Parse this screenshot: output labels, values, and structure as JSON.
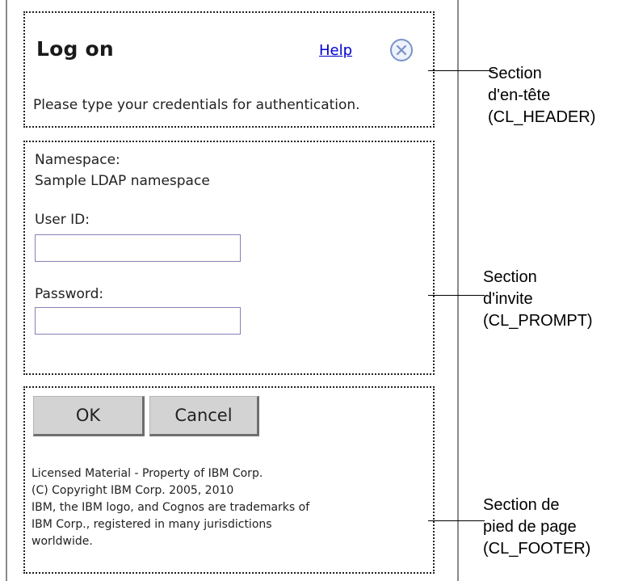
{
  "dialog": {
    "title": "Log on",
    "help_label": "Help",
    "close_icon": "close-circle-x",
    "subtitle": "Please type your credentials for authentication."
  },
  "prompt": {
    "namespace_label": "Namespace:",
    "namespace_value": "Sample LDAP namespace",
    "user_id_label": "User ID:",
    "user_id_value": "",
    "password_label": "Password:",
    "password_value": ""
  },
  "footer": {
    "ok_label": "OK",
    "cancel_label": "Cancel",
    "legal_lines": [
      "Licensed Material - Property of IBM Corp.",
      "(C) Copyright IBM Corp. 2005, 2010",
      "IBM, the IBM logo, and Cognos are trademarks of",
      "IBM Corp., registered in many jurisdictions",
      "worldwide."
    ]
  },
  "annotations": {
    "header": [
      "Section",
      "d'en-tête",
      "(CL_HEADER)"
    ],
    "prompt": [
      "Section",
      "d'invite",
      "(CL_PROMPT)"
    ],
    "footer": [
      "Section de",
      "pied de page",
      "(CL_FOOTER)"
    ]
  },
  "colors": {
    "link": "#0000cc",
    "close_icon": "#7a93c9",
    "button_face": "#d3d3d3",
    "input_border": "#8a7fb8"
  }
}
